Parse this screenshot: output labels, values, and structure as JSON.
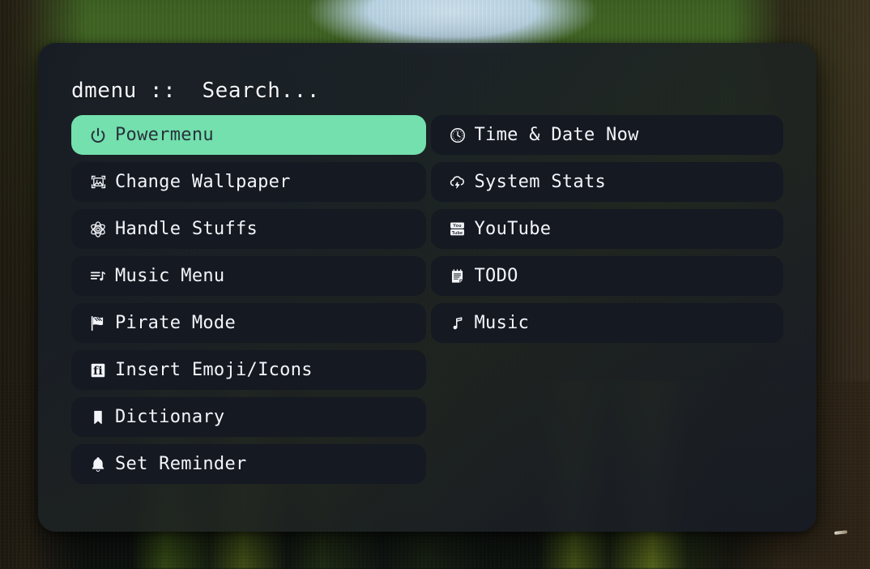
{
  "app": {
    "name": "dmenu",
    "prompt": "dmenu ::  Search...",
    "accent_selected_bg": "#73e0ad",
    "accent_selected_fg": "#28323c",
    "item_bg": "#141922",
    "item_fg": "#f3f5f9",
    "panel_bg": "#191e26"
  },
  "menu": {
    "left_column": [
      {
        "label": "Powermenu",
        "icon": "power-icon",
        "selected": true
      },
      {
        "label": "Change Wallpaper",
        "icon": "image-icon",
        "selected": false
      },
      {
        "label": "Handle Stuffs",
        "icon": "atom-icon",
        "selected": false
      },
      {
        "label": "Music Menu",
        "icon": "playlist-music-icon",
        "selected": false
      },
      {
        "label": "Pirate Mode",
        "icon": "flag-icon",
        "selected": false
      },
      {
        "label": "Insert Emoji/Icons",
        "icon": "glyph-fi-icon",
        "selected": false
      },
      {
        "label": "Dictionary",
        "icon": "bookmark-icon",
        "selected": false
      },
      {
        "label": "Set Reminder",
        "icon": "bell-icon",
        "selected": false
      }
    ],
    "right_column": [
      {
        "label": "Time & Date Now",
        "icon": "clock-icon",
        "selected": false
      },
      {
        "label": "System Stats",
        "icon": "cloud-lightning-icon",
        "selected": false
      },
      {
        "label": "YouTube",
        "icon": "youtube-icon",
        "selected": false
      },
      {
        "label": "TODO",
        "icon": "notepad-icon",
        "selected": false
      },
      {
        "label": "Music",
        "icon": "music-note-icon",
        "selected": false
      }
    ]
  }
}
